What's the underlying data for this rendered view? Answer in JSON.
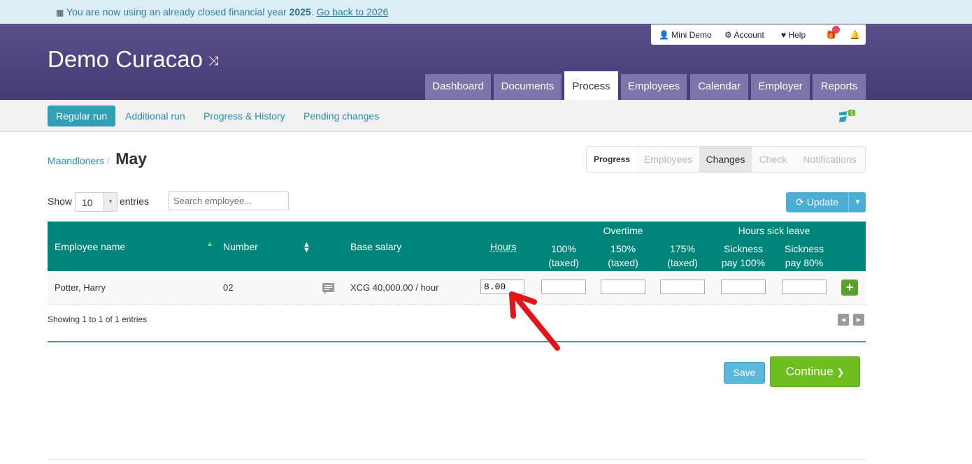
{
  "notice": {
    "prefix": "You are now using an already closed financial year",
    "year": "2025",
    "link": "Go back to 2026"
  },
  "header": {
    "company": "Demo Curacao",
    "user_menu": [
      "Mini Demo",
      "Account",
      "Help"
    ],
    "tabs": [
      "Dashboard",
      "Documents",
      "Process",
      "Employees",
      "Calendar",
      "Employer",
      "Reports"
    ],
    "active_tab": "Process"
  },
  "subnav": {
    "items": [
      "Regular run",
      "Additional run",
      "Progress & History",
      "Pending changes"
    ],
    "active": "Regular run"
  },
  "breadcrumb": {
    "parent": "Maandloners",
    "current": "May"
  },
  "steps": [
    "Progress",
    "Employees",
    "Changes",
    "Check",
    "Notifications"
  ],
  "current_step": "Changes",
  "table_controls": {
    "show_label": "Show",
    "entries_value": "10",
    "entries_label": "entries",
    "search_placeholder": "Search employee...",
    "update_label": "Update"
  },
  "table": {
    "headers": {
      "employee_name": "Employee name",
      "number": "Number",
      "base_salary": "Base salary",
      "hours": "Hours",
      "overtime_group": "Overtime",
      "ot100_a": "100%",
      "ot100_b": "(taxed)",
      "ot150_a": "150%",
      "ot150_b": "(taxed)",
      "ot175_a": "175%",
      "ot175_b": "(taxed)",
      "sick_group": "Hours sick leave",
      "sick100_a": "Sickness",
      "sick100_b": "pay 100%",
      "sick80_a": "Sickness",
      "sick80_b": "pay 80%"
    },
    "rows": [
      {
        "name": "Potter, Harry",
        "number": "02",
        "salary": "XCG 40,000.00 / hour",
        "hours": "8.00",
        "ot100": "",
        "ot150": "",
        "ot175": "",
        "sick100": "",
        "sick80": ""
      }
    ],
    "info": "Showing 1 to 1 of 1 entries"
  },
  "actions": {
    "save": "Save",
    "continue": "Continue"
  },
  "colors": {
    "header": "#463b74",
    "table_header": "#00857a",
    "accent": "#31a0b6",
    "continue": "#6dbf1f",
    "annotation_arrow": "#e0161b"
  }
}
